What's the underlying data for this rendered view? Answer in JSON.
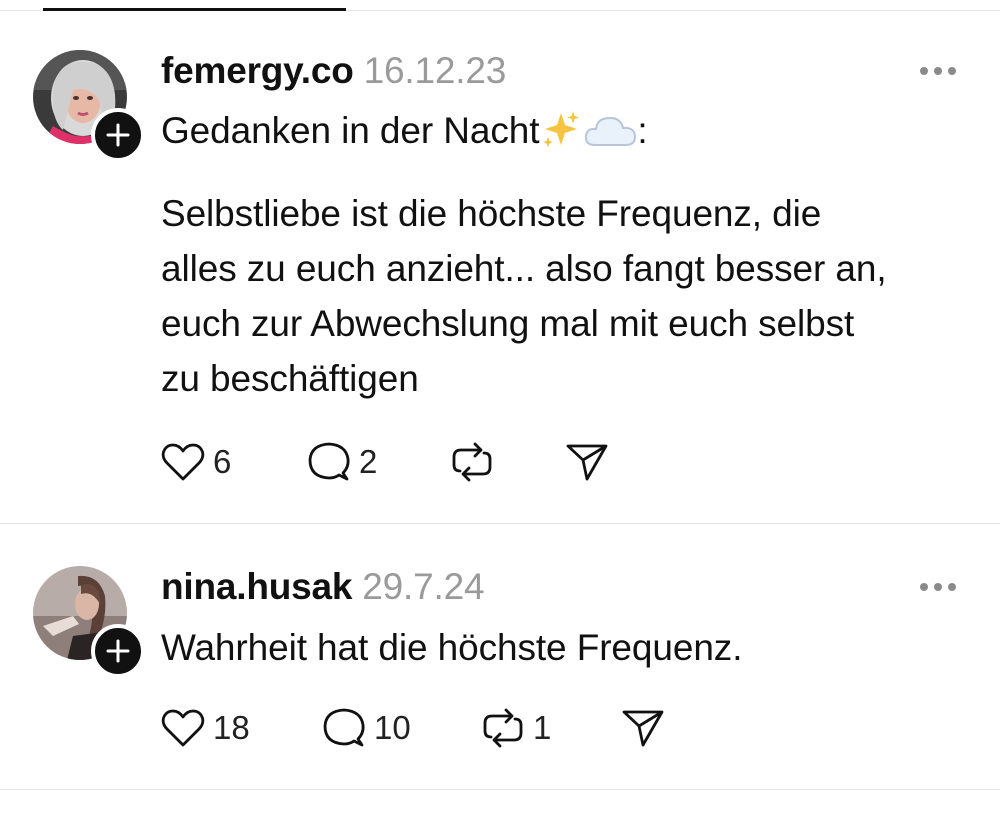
{
  "posts": [
    {
      "username": "femergy.co",
      "date": "16.12.23",
      "title": "Gedanken in der Nacht",
      "title_suffix": ":",
      "title_icons": [
        "sparkles-emoji",
        "cloud-emoji"
      ],
      "body_lines": [
        "Selbstliebe ist die höchste Frequenz, die",
        "alles zu euch anzieht... also fangt besser an,",
        "euch zur Abwechslung mal mit euch selbst",
        "zu beschäftigen"
      ],
      "likes": "6",
      "replies": "2",
      "reposts": "",
      "avatar_icon": "profile-photo"
    },
    {
      "username": "nina.husak",
      "date": "29.7.24",
      "body_lines": [
        "Wahrheit hat die höchste Frequenz."
      ],
      "likes": "18",
      "replies": "10",
      "reposts": "1",
      "avatar_icon": "profile-photo"
    }
  ],
  "icons": {
    "like": "heart-icon",
    "reply": "comment-icon",
    "repost": "repost-icon",
    "share": "send-icon",
    "more": "more-icon",
    "follow": "plus-icon"
  }
}
